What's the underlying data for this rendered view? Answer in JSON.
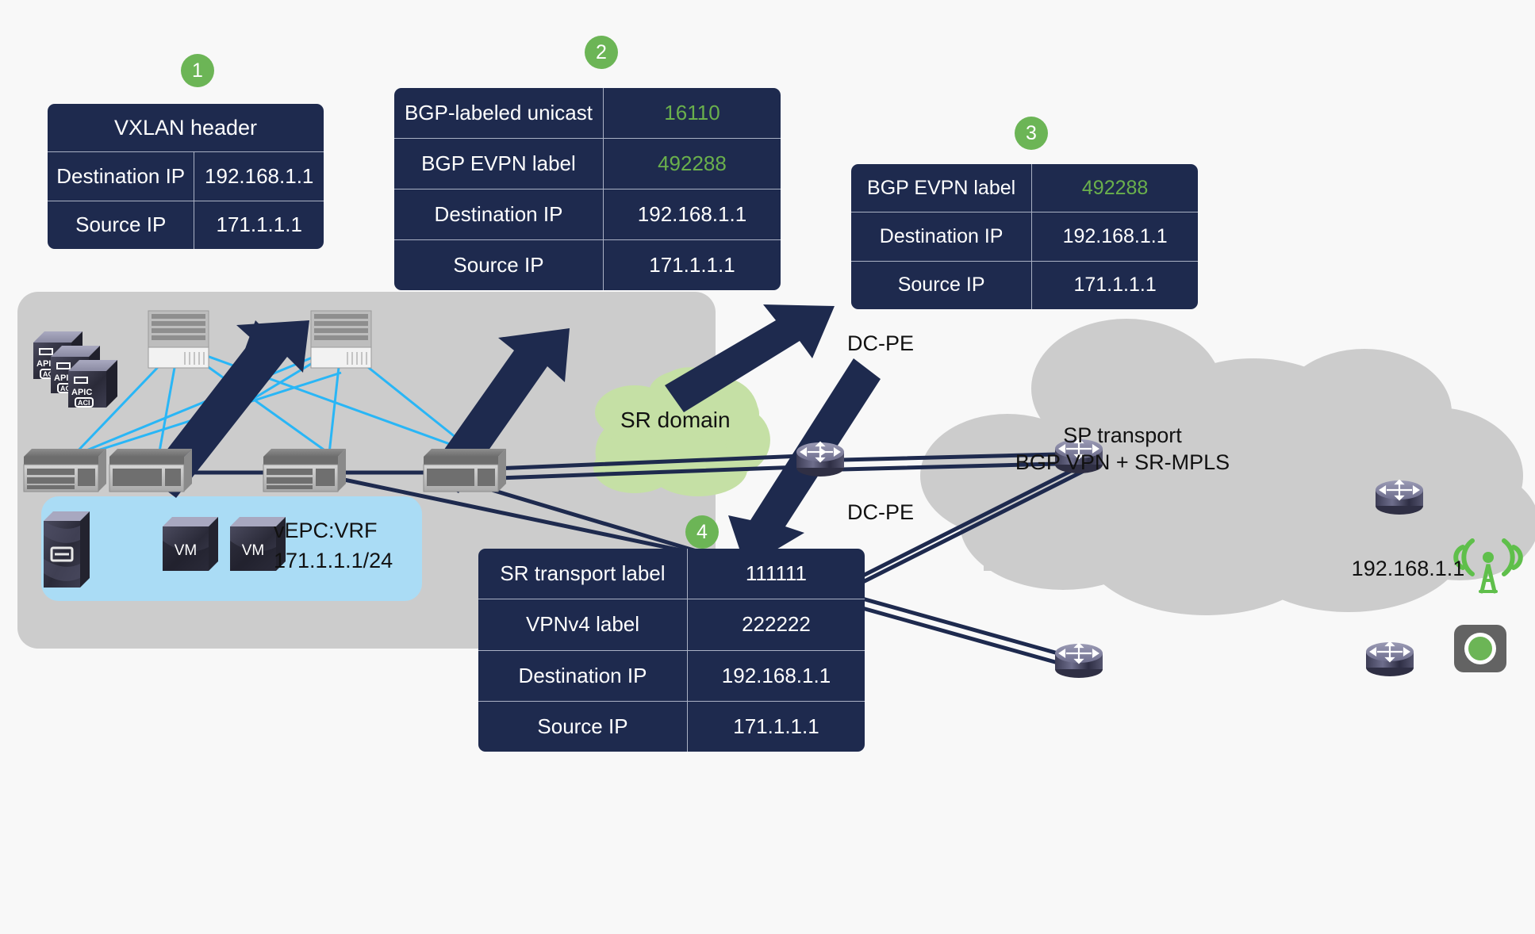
{
  "diagram": {
    "title_context": "ACI to SP transport label stack walkthrough",
    "background_color": "#f8f8f8",
    "accent_navy": "#1e2a4e",
    "accent_green": "#6cb556",
    "value_green": "#6ab04c",
    "dc_region_color": "#cccccc",
    "vepc_region_color": "#aadcf5",
    "link_cyan": "#29b6f6"
  },
  "badges": [
    {
      "id": "badge1",
      "label": "1"
    },
    {
      "id": "badge2",
      "label": "2"
    },
    {
      "id": "badge3",
      "label": "3"
    },
    {
      "id": "badge4",
      "label": "4"
    }
  ],
  "tables": {
    "table1": {
      "title": "VXLAN header",
      "rows": [
        {
          "key": "Destination IP",
          "value": "192.168.1.1",
          "green": false
        },
        {
          "key": "Source IP",
          "value": "171.1.1.1",
          "green": false
        }
      ]
    },
    "table2": {
      "rows": [
        {
          "key": "BGP-labeled unicast",
          "value": "16110",
          "green": true
        },
        {
          "key": "BGP EVPN label",
          "value": "492288",
          "green": true
        },
        {
          "key": "Destination IP",
          "value": "192.168.1.1",
          "green": false
        },
        {
          "key": "Source IP",
          "value": "171.1.1.1",
          "green": false
        }
      ]
    },
    "table3": {
      "rows": [
        {
          "key": "BGP EVPN label",
          "value": "492288",
          "green": true
        },
        {
          "key": "Destination IP",
          "value": "192.168.1.1",
          "green": false
        },
        {
          "key": "Source IP",
          "value": "171.1.1.1",
          "green": false
        }
      ]
    },
    "table4": {
      "rows": [
        {
          "key": "SR transport label",
          "value": "111111",
          "green": false
        },
        {
          "key": "VPNv4 label",
          "value": "222222",
          "green": false
        },
        {
          "key": "Destination IP",
          "value": "192.168.1.1",
          "green": false
        },
        {
          "key": "Source IP",
          "value": "171.1.1.1",
          "green": false
        }
      ]
    }
  },
  "labels": {
    "sr_domain": "SR domain",
    "sp_transport": "SP transport\nBGP VPN + SR-MPLS",
    "dc_pe_top": "DC-PE",
    "dc_pe_bottom": "DC-PE",
    "endpoint_ip": "192.168.1.1",
    "vepc": "vEPC:VRF\n171.1.1.1/24"
  },
  "icons": {
    "apic_text": "APIC",
    "aci_text": "ACI",
    "vm_text": "VM"
  }
}
